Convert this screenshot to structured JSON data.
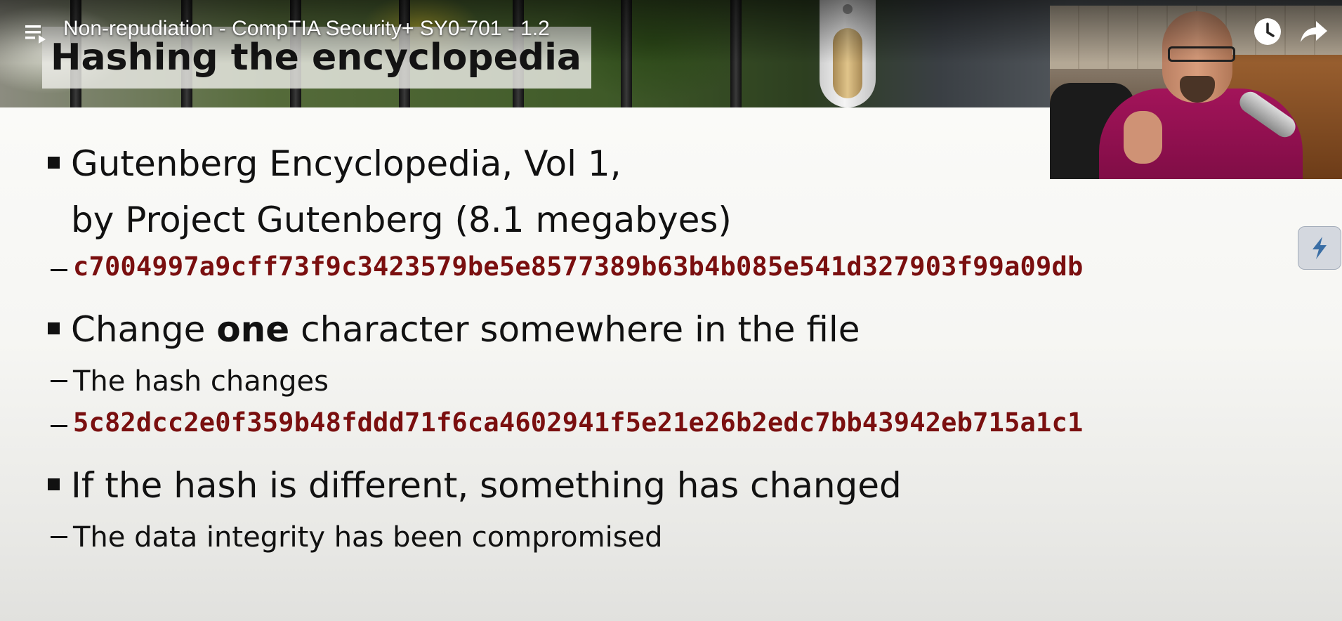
{
  "player": {
    "video_title": "Non-repudiation - CompTIA Security+ SY0-701 - 1.2",
    "icons": {
      "playlist": "playlist-icon",
      "watch_later": "clock-icon",
      "share": "share-arrow-icon",
      "side_widget": "lightning-icon"
    }
  },
  "slide": {
    "title": "Hashing the encyclopedia",
    "bullets": [
      {
        "line1": "Gutenberg Encyclopedia, Vol 1,",
        "line2": "by Project Gutenberg (8.1 megabyes)",
        "hash": "c7004997a9cff73f9c3423579be5e8577389b63b4b085e541d327903f99a09db"
      },
      {
        "text_pre": "Change ",
        "text_bold": "one",
        "text_post": " character somewhere in the file",
        "sub": "The hash changes",
        "hash": "5c82dcc2e0f359b48fddd71f6ca4602941f5e21e26b2edc7bb43942eb715a1c1"
      },
      {
        "text": "If the hash is different, something has changed",
        "sub": "The data integrity has been compromised"
      }
    ],
    "colors": {
      "hash_text": "#7a0f0f",
      "body_text": "#111111"
    }
  }
}
